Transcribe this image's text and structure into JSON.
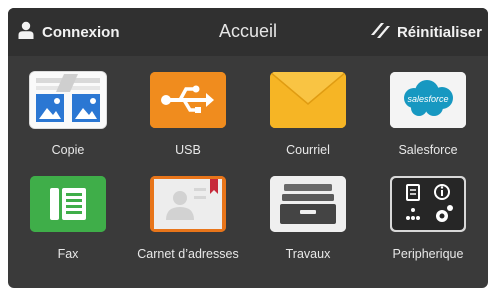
{
  "header": {
    "login_label": "Connexion",
    "title": "Accueil",
    "reset_label": "Réinitialiser"
  },
  "apps": [
    {
      "label": "Copie",
      "icon": "copy-icon"
    },
    {
      "label": "USB",
      "icon": "usb-icon"
    },
    {
      "label": "Courriel",
      "icon": "email-icon"
    },
    {
      "label": "Salesforce",
      "icon": "salesforce-icon",
      "logo_text": "salesforce"
    },
    {
      "label": "Fax",
      "icon": "fax-icon"
    },
    {
      "label": "Carnet d’adresses",
      "icon": "address-book-icon"
    },
    {
      "label": "Travaux",
      "icon": "jobs-tray-icon"
    },
    {
      "label": "Peripherique",
      "icon": "device-icon"
    }
  ],
  "colors": {
    "background": "#3a3a3a",
    "header": "#303030",
    "usb_orange": "#f08c1e",
    "email_yellow": "#f5b323",
    "salesforce_blue": "#1798c1",
    "fax_green": "#3fae49"
  }
}
